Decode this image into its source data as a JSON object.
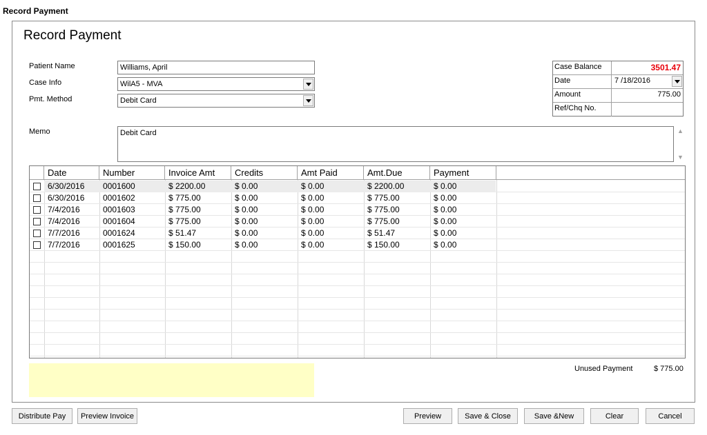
{
  "window": {
    "title": "Record Payment"
  },
  "form": {
    "heading": "Record Payment",
    "patient_name_label": "Patient Name",
    "patient_name_value": "Williams, April",
    "case_info_label": "Case Info",
    "case_info_value": "WilA5 - MVA",
    "pmt_method_label": "Pmt. Method",
    "pmt_method_value": "Debit Card",
    "memo_label": "Memo",
    "memo_value": "Debit Card"
  },
  "info": {
    "case_balance_label": "Case Balance",
    "case_balance_value": "3501.47",
    "date_label": "Date",
    "date_value": "7 /18/2016",
    "amount_label": "Amount",
    "amount_value": "775.00",
    "ref_label": "Ref/Chq No.",
    "ref_value": ""
  },
  "grid": {
    "columns": [
      "Date",
      "Number",
      "Invoice Amt",
      "Credits",
      "Amt Paid",
      "Amt.Due",
      "Payment"
    ],
    "rows": [
      [
        "6/30/2016",
        "0001600",
        "$ 2200.00",
        "$ 0.00",
        "$ 0.00",
        "$ 2200.00",
        "$ 0.00"
      ],
      [
        "6/30/2016",
        "0001602",
        "$ 775.00",
        "$ 0.00",
        "$ 0.00",
        "$ 775.00",
        "$ 0.00"
      ],
      [
        "7/4/2016",
        "0001603",
        "$ 775.00",
        "$ 0.00",
        "$ 0.00",
        "$ 775.00",
        "$ 0.00"
      ],
      [
        "7/4/2016",
        "0001604",
        "$ 775.00",
        "$ 0.00",
        "$ 0.00",
        "$ 775.00",
        "$ 0.00"
      ],
      [
        "7/7/2016",
        "0001624",
        "$ 51.47",
        "$ 0.00",
        "$ 0.00",
        "$ 51.47",
        "$ 0.00"
      ],
      [
        "7/7/2016",
        "0001625",
        "$ 150.00",
        "$ 0.00",
        "$ 0.00",
        "$ 150.00",
        "$ 0.00"
      ]
    ]
  },
  "footer": {
    "unused_label": "Unused Payment",
    "unused_value": "$ 775.00"
  },
  "buttons": {
    "distribute_pay": "Distribute Pay",
    "preview_invoice": "Preview Invoice",
    "preview": "Preview",
    "save_close": "Save & Close",
    "save_new": "Save &New",
    "clear": "Clear",
    "cancel": "Cancel"
  },
  "colors": {
    "balance": "#e8000b",
    "note_area": "#ffffc6"
  }
}
